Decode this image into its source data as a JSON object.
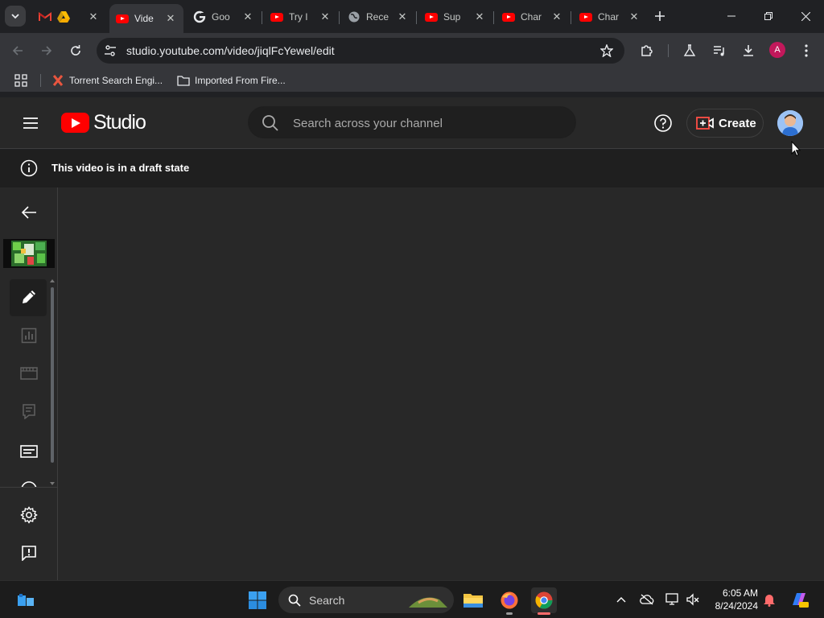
{
  "browser": {
    "tabs": [
      {
        "title": "",
        "favicon": "gmail-drive-icons"
      },
      {
        "title": "Vide",
        "favicon": "youtube-icon",
        "active": true
      },
      {
        "title": "Goo",
        "favicon": "google-icon"
      },
      {
        "title": "Try I",
        "favicon": "youtube-icon"
      },
      {
        "title": "Rece",
        "favicon": "globe-icon"
      },
      {
        "title": "Sup",
        "favicon": "youtube-icon"
      },
      {
        "title": "Char",
        "favicon": "youtube-icon"
      },
      {
        "title": "Char",
        "favicon": "youtube-icon"
      }
    ],
    "url": "studio.youtube.com/video/jiqlFcYewel/edit",
    "bookmarks": [
      {
        "label": "Torrent Search Engi...",
        "icon": "torrent-x-icon"
      },
      {
        "label": "Imported From Fire...",
        "icon": "folder-icon"
      }
    ],
    "profile_initial": "A"
  },
  "studio": {
    "logo_text": "Studio",
    "search_placeholder": "Search across your channel",
    "create_label": "Create",
    "draft_message": "This video is in a draft state"
  },
  "taskbar": {
    "search_label": "Search",
    "time": "6:05 AM",
    "date": "8/24/2024"
  },
  "colors": {
    "youtube_red": "#ff0000",
    "studio_bg": "#282828",
    "banner_bg": "#1f1f1f",
    "chrome_toolbar": "#35363a"
  }
}
